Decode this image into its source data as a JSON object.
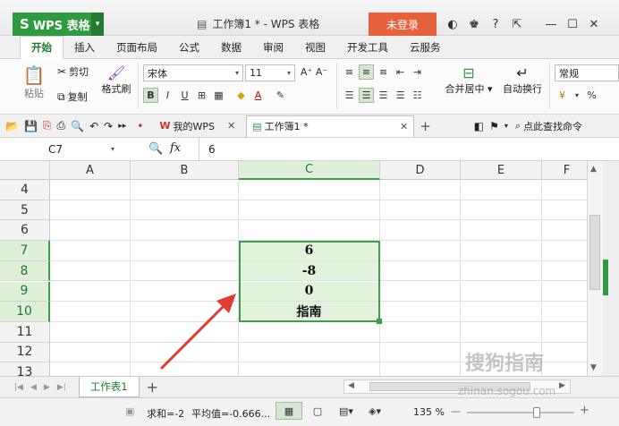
{
  "titlebar": {
    "app_name": "WPS 表格",
    "doc_title": "工作簿1 * - WPS 表格",
    "login": "未登录",
    "icons": [
      "skin-icon",
      "shirt-icon",
      "help-icon",
      "restore-ribbon-icon",
      "minimize-icon",
      "maximize-icon",
      "close-icon"
    ]
  },
  "ribbon_tabs": [
    "开始",
    "插入",
    "页面布局",
    "公式",
    "数据",
    "审阅",
    "视图",
    "开发工具",
    "云服务"
  ],
  "ribbon": {
    "paste": "粘贴",
    "cut": "剪切",
    "copy": "复制",
    "format_painter": "格式刷",
    "font_name": "宋体",
    "font_size": "11",
    "merge": "合并居中",
    "wrap": "自动换行",
    "number_format": "常规",
    "percent": "%"
  },
  "docstrip": {
    "my_wps": "我的WPS",
    "workbook_tab": "工作簿1 *",
    "search": "点此查找命令"
  },
  "formula_bar": {
    "name_box": "C7",
    "fx": "fx",
    "value": "6"
  },
  "grid": {
    "columns": [
      "A",
      "B",
      "C",
      "D",
      "E",
      "F"
    ],
    "rows": [
      "4",
      "5",
      "6",
      "7",
      "8",
      "9",
      "10",
      "11",
      "12",
      "13"
    ],
    "values": {
      "C7": "6",
      "C8": "-8",
      "C9": "0",
      "C10": "指南"
    }
  },
  "sheets": [
    "工作表1"
  ],
  "status": {
    "sum": "求和=-2",
    "avg": "平均值=-0.666...",
    "zoom": "135 %"
  },
  "watermark": {
    "brand": "搜狗指南",
    "url": "zhinan.sogou.com"
  },
  "colors": {
    "accent": "#2f9a41",
    "login": "#e8613d",
    "selection": "#e2f2dc",
    "arrow": "#e23b30"
  }
}
